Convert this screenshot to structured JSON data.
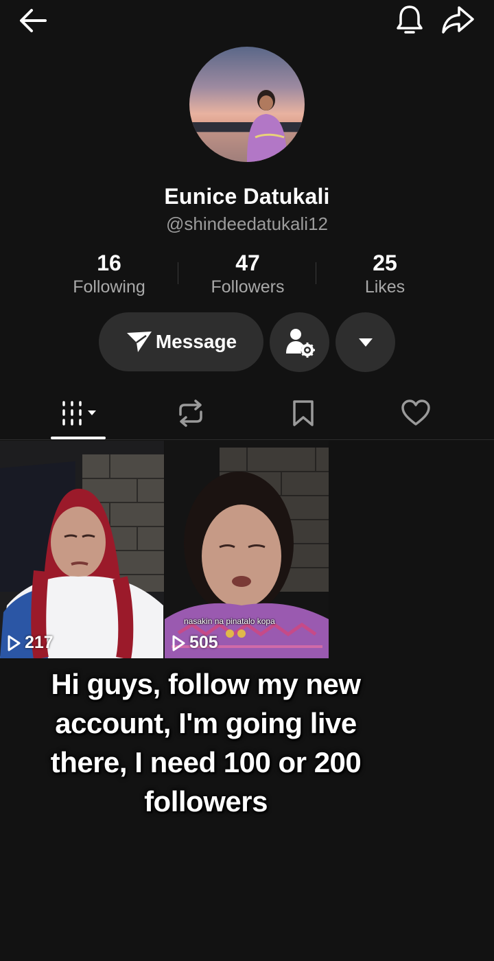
{
  "header": {
    "back_icon": "arrow-left-icon",
    "bell_icon": "bell-icon",
    "share_icon": "share-arrow-icon"
  },
  "profile": {
    "name": "Eunice Datukali",
    "handle": "@shindeedatukali12"
  },
  "stats": [
    {
      "value": "16",
      "label": "Following"
    },
    {
      "value": "47",
      "label": "Followers"
    },
    {
      "value": "25",
      "label": "Likes"
    }
  ],
  "actions": {
    "message_label": "Message",
    "message_icon": "send-plane-icon",
    "profile_settings_icon": "user-gear-icon",
    "more_icon": "caret-down-icon"
  },
  "tabs": [
    {
      "name": "videos",
      "icon": "grid-bars-icon",
      "active": true
    },
    {
      "name": "reposts",
      "icon": "repost-icon",
      "active": false
    },
    {
      "name": "saved",
      "icon": "bookmark-icon",
      "active": false
    },
    {
      "name": "liked",
      "icon": "heart-icon",
      "active": false
    }
  ],
  "videos": [
    {
      "views": "217"
    },
    {
      "views": "505",
      "caption": "nasakin na pinatalo kopa"
    }
  ],
  "overlay_text": "Hi guys, follow my new account, I'm going live there, I need 100 or 200 followers",
  "colors": {
    "background": "#121212",
    "button_bg": "#2e2e2e",
    "secondary_text": "#a9a9a9"
  }
}
